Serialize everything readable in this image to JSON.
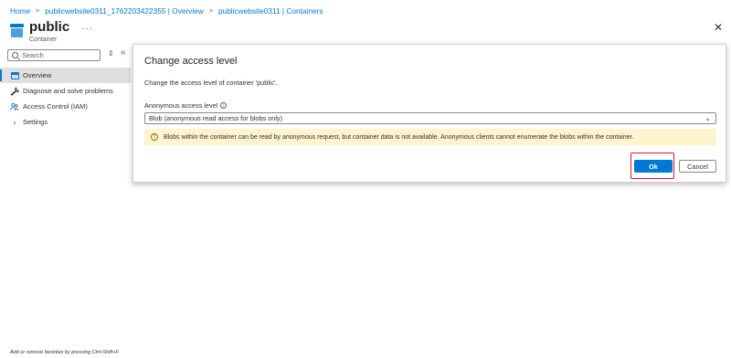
{
  "breadcrumb": {
    "items": [
      "Home",
      "publicwebsite0311_1762203422355 | Overview",
      "publicwebsite0311 | Containers"
    ]
  },
  "resource": {
    "title": "public",
    "subtitle": "Container",
    "more": "···"
  },
  "sidebar": {
    "search_placeholder": "Search",
    "items": [
      {
        "label": "Overview",
        "icon": "overview-icon",
        "active": true
      },
      {
        "label": "Diagnose and solve problems",
        "icon": "wrench-icon"
      },
      {
        "label": "Access Control (IAM)",
        "icon": "people-icon"
      },
      {
        "label": "Settings",
        "icon": "chevron-right-icon"
      }
    ],
    "favorites_hint": "Add or remove favorites by pressing Ctrl+Shift+F"
  },
  "dialog": {
    "title": "Change access level",
    "description": "Change the access level of container 'public'.",
    "field_label": "Anonymous access level",
    "selected_value": "Blob (anonymous read access for blobs only)",
    "warning": "Blobs within the container can be read by anonymous request, but container data is not available. Anonymous clients cannot enumerate the blobs within the container.",
    "ok_label": "Ok",
    "cancel_label": "Cancel"
  },
  "colors": {
    "accent": "#0078d4",
    "warning_bg": "#fff4ce",
    "highlight": "#e81123"
  }
}
